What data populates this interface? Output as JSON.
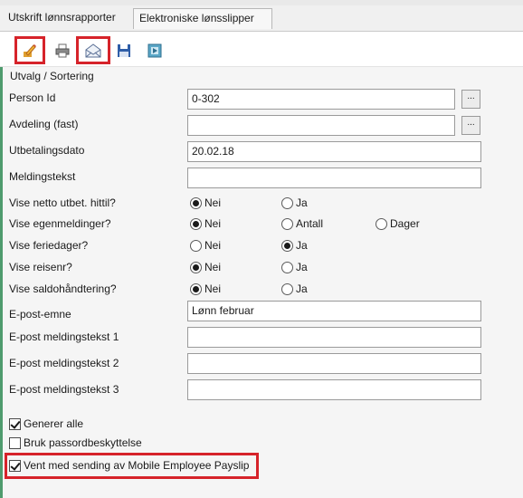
{
  "tabs": [
    {
      "label": "Utskrift lønnsrapporter"
    },
    {
      "label": "Elektroniske lønsslipper"
    }
  ],
  "toolbar": {
    "icons": [
      "edit-pencil-icon",
      "print-icon",
      "email-envelope-icon",
      "save-disk-icon",
      "export-icon"
    ],
    "highlight_color": "#d6232a"
  },
  "section_title": "Utvalg / Sortering",
  "fields": {
    "person_id": {
      "label": "Person Id",
      "value": "0-302",
      "lookup": "..."
    },
    "avdeling": {
      "label": "Avdeling (fast)",
      "value": "",
      "lookup": "..."
    },
    "utbetalingsdato": {
      "label": "Utbetalingsdato",
      "value": "20.02.18"
    },
    "meldingstekst": {
      "label": "Meldingstekst",
      "value": ""
    },
    "epost_emne": {
      "label": "E-post-emne",
      "value": "Lønn februar"
    },
    "epost_tekst1": {
      "label": "E-post meldingstekst 1",
      "value": ""
    },
    "epost_tekst2": {
      "label": "E-post meldingstekst 2",
      "value": ""
    },
    "epost_tekst3": {
      "label": "E-post meldingstekst 3",
      "value": ""
    }
  },
  "radios": {
    "netto": {
      "label": "Vise netto utbet. hittil?",
      "options": [
        "Nei",
        "Ja"
      ],
      "selected": "Nei"
    },
    "egenmeldinger": {
      "label": "Vise egenmeldinger?",
      "options": [
        "Nei",
        "Antall",
        "Dager"
      ],
      "selected": "Nei"
    },
    "feriedager": {
      "label": "Vise feriedager?",
      "options": [
        "Nei",
        "Ja"
      ],
      "selected": "Ja"
    },
    "reisenr": {
      "label": "Vise reisenr?",
      "options": [
        "Nei",
        "Ja"
      ],
      "selected": "Nei"
    },
    "saldo": {
      "label": "Vise saldohåndtering?",
      "options": [
        "Nei",
        "Ja"
      ],
      "selected": "Nei"
    }
  },
  "checkboxes": {
    "generer_alle": {
      "label": "Generer alle",
      "checked": true
    },
    "passord": {
      "label": "Bruk passordbeskyttelse",
      "checked": false
    },
    "vent": {
      "label": "Vent med sending av Mobile Employee Payslip",
      "checked": true
    }
  },
  "colors": {
    "accent_green": "#4f9b6e",
    "highlight_red": "#d6232a"
  }
}
